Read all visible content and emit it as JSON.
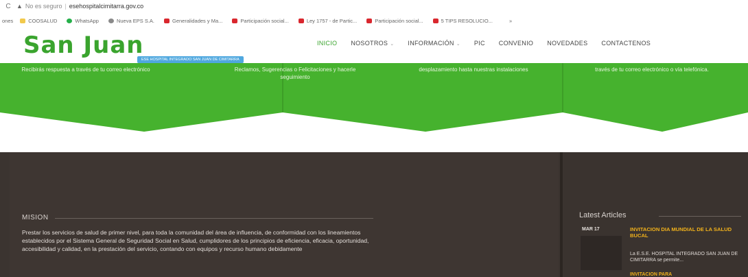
{
  "browser": {
    "insecure_label": "No es seguro",
    "url": "esehospitalcimitarra.gov.co",
    "bookmarks": [
      {
        "label": "ones",
        "color": ""
      },
      {
        "label": "COOSALUD",
        "color": "#f2c94c"
      },
      {
        "label": "WhatsApp",
        "color": "#25b04a"
      },
      {
        "label": "Nueva EPS S.A.",
        "color": "#8a8a8a"
      },
      {
        "label": "Generalidades y Ma...",
        "color": "#d9272e"
      },
      {
        "label": "Participación social...",
        "color": "#d9272e"
      },
      {
        "label": "Ley 1757 - de Partic...",
        "color": "#d9272e"
      },
      {
        "label": "Participación social...",
        "color": "#d9272e"
      },
      {
        "label": "5 TIPS RESOLUCIO...",
        "color": "#d9272e"
      }
    ],
    "bookmarks_more": "»"
  },
  "site": {
    "logo_text": "San Juan",
    "logo_tag": "ESE HOSPITAL INTEGRADO SAN JUAN DE CIMITARRA",
    "nav": [
      {
        "label": "INICIO",
        "dropdown": false,
        "active": true
      },
      {
        "label": "NOSOTROS",
        "dropdown": true,
        "active": false
      },
      {
        "label": "INFORMACIÓN",
        "dropdown": true,
        "active": false
      },
      {
        "label": "PIC",
        "dropdown": false,
        "active": false
      },
      {
        "label": "CONVENIO",
        "dropdown": false,
        "active": false
      },
      {
        "label": "NOVEDADES",
        "dropdown": false,
        "active": false
      },
      {
        "label": "CONTACTENOS",
        "dropdown": false,
        "active": false
      }
    ]
  },
  "banner": {
    "col1": "Recibirás respuesta a través de tu correo electrónico",
    "col2": "Reclamos, Sugerencias o Felicitaciones y hacerle seguimiento",
    "col3": "desplazamiento hasta nuestras instalaciones",
    "col4": "través de tu correo electrónico o vía telefónica."
  },
  "mision": {
    "title": "MISION",
    "text": "Prestar los servicios de salud de primer nivel, para toda la comunidad del área de influencia, de conformidad con los lineamientos establecidos por el Sistema General de Seguridad Social en Salud, cumplidores de los principios de eficiencia, eficacia, oportunidad, accesibilidad y calidad, en la prestación del servicio, contando con equipos y recurso humano debidamente"
  },
  "latest": {
    "title": "Latest Articles",
    "article": {
      "date": "MAR 17",
      "title": "INVITACION DIA MUNDIAL DE LA SALUD BUCAL",
      "excerpt": "La E.S.E. HOSPITAL INTEGRADO SAN JUAN DE CIMITARRA se permite...",
      "next_title": "INVITACION PARA"
    }
  },
  "colors": {
    "green": "#46b22e",
    "dark": "#3b3430",
    "accent_orange": "#f2b21b",
    "logo_green": "#3aa42e",
    "tag_blue": "#4fa8df"
  }
}
